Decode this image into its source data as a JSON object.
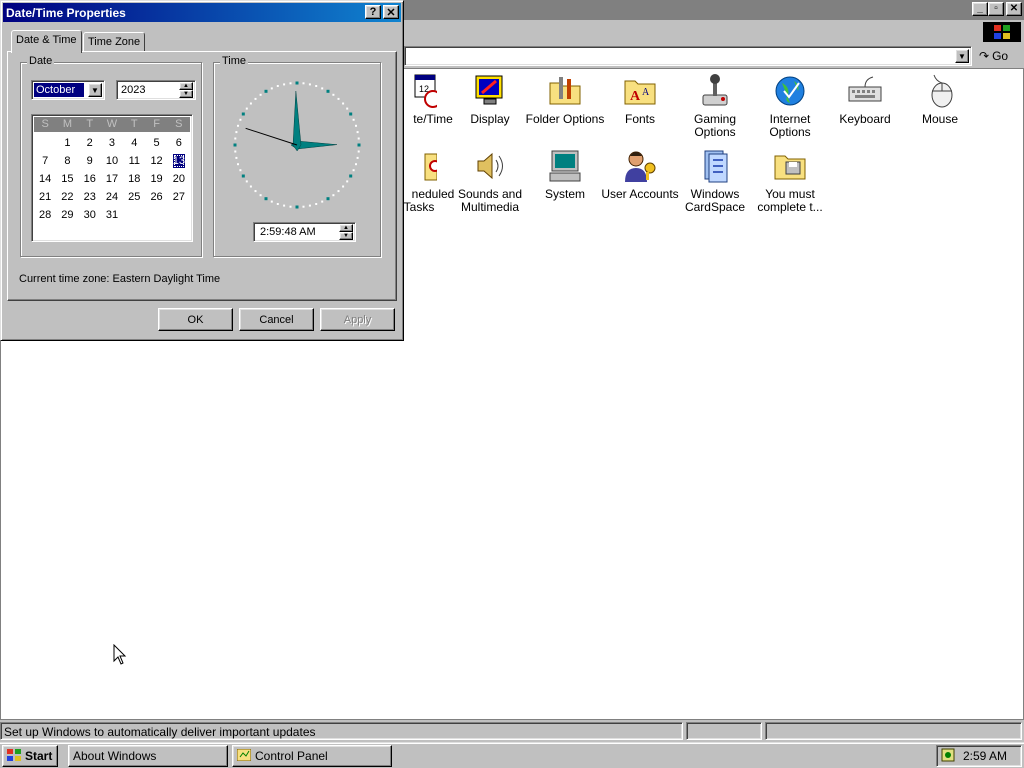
{
  "dialog": {
    "title": "Date/Time Properties",
    "help_glyph": "?",
    "close_glyph": "✕",
    "tabs": [
      {
        "label": "Date & Time",
        "active": true
      },
      {
        "label": "Time Zone",
        "active": false
      }
    ],
    "date_group_label": "Date",
    "time_group_label": "Time",
    "month": "October",
    "year": "2023",
    "weekday_headers": [
      "S",
      "M",
      "T",
      "W",
      "T",
      "F",
      "S"
    ],
    "calendar_days": [
      "",
      "1",
      "2",
      "3",
      "4",
      "5",
      "6",
      "7",
      "8",
      "9",
      "10",
      "11",
      "12",
      "13",
      "14",
      "15",
      "16",
      "17",
      "18",
      "19",
      "20",
      "21",
      "22",
      "23",
      "24",
      "25",
      "26",
      "27",
      "28",
      "29",
      "30",
      "31"
    ],
    "selected_day": "13",
    "time": "2:59:48 AM",
    "clock": {
      "hour": 2,
      "minute": 59,
      "second": 48
    },
    "timezone_text": "Current time zone:  Eastern Daylight Time",
    "buttons": {
      "ok": "OK",
      "cancel": "Cancel",
      "apply": "Apply"
    }
  },
  "control_panel": {
    "address_go": "Go",
    "icons_row1": [
      "te/Time",
      "Display",
      "Folder Options",
      "Fonts",
      "Gaming Options",
      "Internet Options",
      "Keyboard",
      "Mouse"
    ],
    "icons_row2": [
      "neduled Tasks",
      "Sounds and Multimedia",
      "System",
      "User Accounts",
      "Windows CardSpace",
      "You must complete t..."
    ],
    "status_text": "Set up Windows to automatically deliver important updates"
  },
  "taskbar": {
    "start_label": "Start",
    "tasks": [
      "About Windows",
      "Control Panel"
    ],
    "clock": "2:59 AM"
  },
  "colors": {
    "title_active": "#000080",
    "face": "#c0c0c0",
    "clock_hands": "#008080"
  }
}
